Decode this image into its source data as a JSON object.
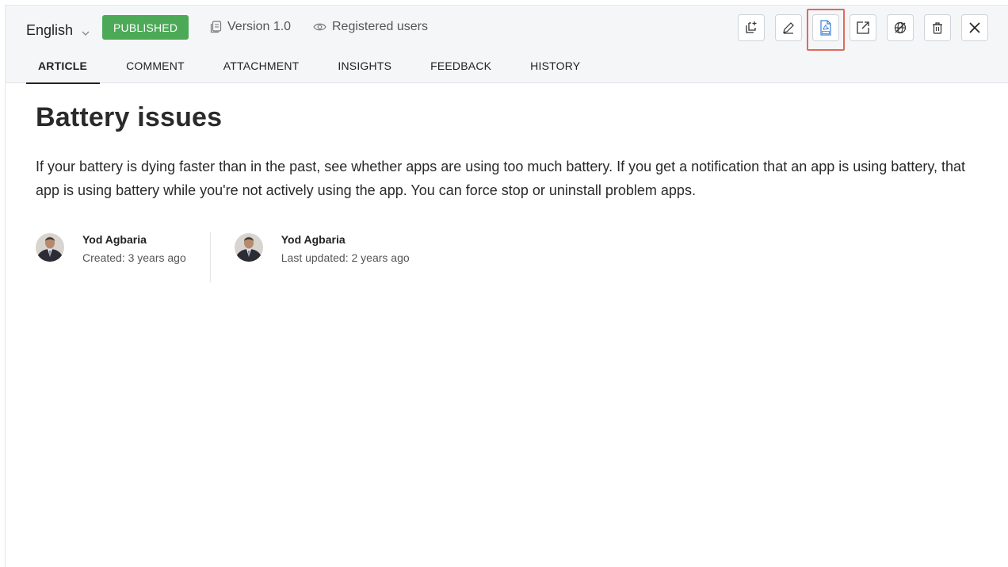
{
  "header": {
    "language": "English",
    "status": "PUBLISHED",
    "version": "Version 1.0",
    "visibility": "Registered users",
    "status_color": "#4caa57",
    "toolbar_icons": [
      "clone-icon",
      "edit-icon",
      "pdf-icon",
      "open-external-icon",
      "translate-icon",
      "delete-icon",
      "close-icon"
    ]
  },
  "tabs": [
    {
      "label": "ARTICLE"
    },
    {
      "label": "COMMENT"
    },
    {
      "label": "ATTACHMENT"
    },
    {
      "label": "INSIGHTS"
    },
    {
      "label": "FEEDBACK"
    },
    {
      "label": "HISTORY"
    }
  ],
  "article": {
    "title": "Battery issues",
    "body": "If your battery is dying faster than in the past, see whether apps are using too much battery. If you get a notification that an app is using battery, that app is using battery while you're not actively using the app. You can force stop or uninstall problem apps."
  },
  "authors": [
    {
      "name": "Yod Agbaria",
      "sub": "Created: 3 years ago"
    },
    {
      "name": "Yod Agbaria",
      "sub": "Last updated: 2 years ago"
    }
  ]
}
